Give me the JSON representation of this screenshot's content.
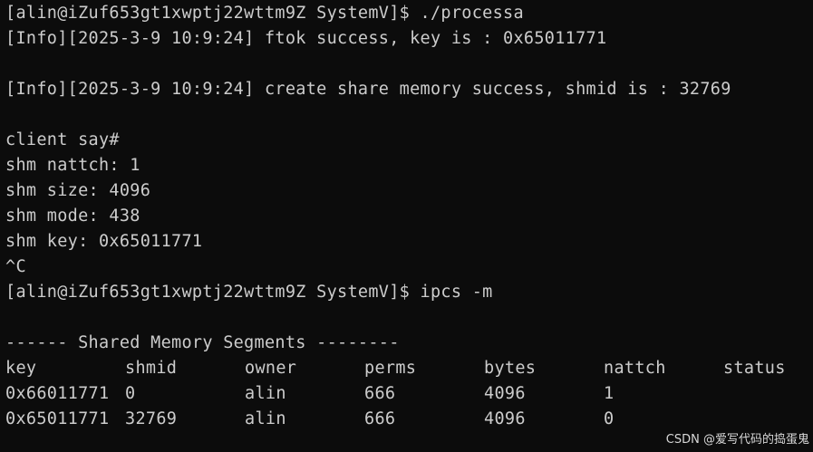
{
  "terminal": {
    "lines": [
      "[alin@iZuf653gt1xwptj22wttm9Z SystemV]$ ./processa",
      "[Info][2025-3-9 10:9:24] ftok success, key is : 0x65011771",
      "",
      "[Info][2025-3-9 10:9:24] create share memory success, shmid is : 32769",
      "",
      "client say#",
      "shm nattch: 1",
      "shm size: 4096",
      "shm mode: 438",
      "shm key: 0x65011771",
      "^C",
      "[alin@iZuf653gt1xwptj22wttm9Z SystemV]$ ipcs -m",
      "",
      "------ Shared Memory Segments --------"
    ],
    "table": {
      "headers": [
        "key",
        "shmid",
        "owner",
        "perms",
        "bytes",
        "nattch",
        "status"
      ],
      "rows": [
        [
          "0x66011771",
          "0",
          "alin",
          "666",
          "4096",
          "1",
          ""
        ],
        [
          "0x65011771",
          "32769",
          "alin",
          "666",
          "4096",
          "0",
          ""
        ]
      ]
    }
  },
  "watermark": "CSDN @爱写代码的捣蛋鬼"
}
